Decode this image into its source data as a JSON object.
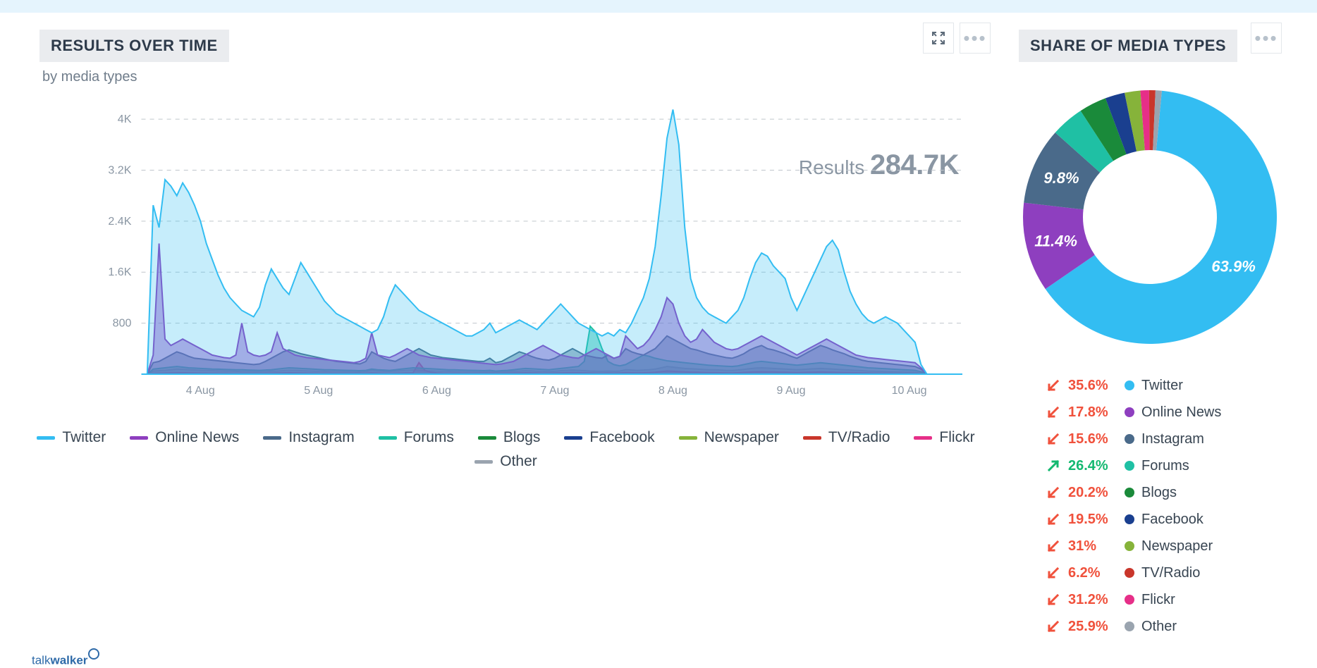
{
  "left": {
    "title": "RESULTS OVER TIME",
    "subtitle": "by media types",
    "results_label": "Results",
    "results_total": "284.7K"
  },
  "right": {
    "title": "SHARE OF MEDIA TYPES"
  },
  "colors": {
    "twitter": "#33bdf2",
    "onlinenews": "#8e3fbf",
    "instagram": "#4a6a8a",
    "forums": "#1fc0a4",
    "blogs": "#1a8a3a",
    "facebook": "#1a3f8f",
    "newspaper": "#86b33a",
    "tvradio": "#c9362b",
    "flickr": "#e62f88",
    "other": "#9aa4af"
  },
  "legend": [
    {
      "key": "twitter",
      "label": "Twitter"
    },
    {
      "key": "onlinenews",
      "label": "Online News"
    },
    {
      "key": "instagram",
      "label": "Instagram"
    },
    {
      "key": "forums",
      "label": "Forums"
    },
    {
      "key": "blogs",
      "label": "Blogs"
    },
    {
      "key": "facebook",
      "label": "Facebook"
    },
    {
      "key": "newspaper",
      "label": "Newspaper"
    },
    {
      "key": "tvradio",
      "label": "TV/Radio"
    },
    {
      "key": "flickr",
      "label": "Flickr"
    },
    {
      "key": "other",
      "label": "Other"
    }
  ],
  "trends": [
    {
      "key": "twitter",
      "label": "Twitter",
      "pct": "35.6%",
      "dir": "down"
    },
    {
      "key": "onlinenews",
      "label": "Online News",
      "pct": "17.8%",
      "dir": "down"
    },
    {
      "key": "instagram",
      "label": "Instagram",
      "pct": "15.6%",
      "dir": "down"
    },
    {
      "key": "forums",
      "label": "Forums",
      "pct": "26.4%",
      "dir": "up"
    },
    {
      "key": "blogs",
      "label": "Blogs",
      "pct": "20.2%",
      "dir": "down"
    },
    {
      "key": "facebook",
      "label": "Facebook",
      "pct": "19.5%",
      "dir": "down"
    },
    {
      "key": "newspaper",
      "label": "Newspaper",
      "pct": "31%",
      "dir": "down"
    },
    {
      "key": "tvradio",
      "label": "TV/Radio",
      "pct": "6.2%",
      "dir": "down"
    },
    {
      "key": "flickr",
      "label": "Flickr",
      "pct": "31.2%",
      "dir": "down"
    },
    {
      "key": "other",
      "label": "Other",
      "pct": "25.9%",
      "dir": "down"
    }
  ],
  "footer_brand": {
    "thin": "talk",
    "bold": "walker"
  },
  "chart_data": {
    "area": {
      "type": "area",
      "title": "Results over time by media types",
      "ylabel": "Results",
      "y_ticks": [
        800,
        1600,
        2400,
        3200,
        4000
      ],
      "y_tick_labels": [
        "800",
        "1.6K",
        "2.4K",
        "3.2K",
        "4K"
      ],
      "ylim": [
        0,
        4200
      ],
      "x_categories": [
        "4 Aug",
        "5 Aug",
        "6 Aug",
        "7 Aug",
        "8 Aug",
        "9 Aug",
        "10 Aug"
      ],
      "samples_per_day": 20,
      "series": [
        {
          "name": "Twitter",
          "key": "twitter",
          "values": [
            0,
            0,
            2650,
            2300,
            3050,
            2950,
            2800,
            3000,
            2850,
            2650,
            2400,
            2050,
            1800,
            1550,
            1350,
            1200,
            1100,
            1000,
            950,
            900,
            1050,
            1400,
            1650,
            1500,
            1350,
            1250,
            1500,
            1750,
            1600,
            1450,
            1300,
            1150,
            1050,
            950,
            900,
            850,
            800,
            750,
            700,
            650,
            700,
            900,
            1200,
            1400,
            1300,
            1200,
            1100,
            1000,
            950,
            900,
            850,
            800,
            750,
            700,
            650,
            600,
            600,
            650,
            700,
            800,
            650,
            700,
            750,
            800,
            850,
            800,
            750,
            700,
            800,
            900,
            1000,
            1100,
            1000,
            900,
            800,
            750,
            700,
            650,
            600,
            650,
            600,
            700,
            650,
            800,
            1000,
            1200,
            1500,
            2000,
            2800,
            3700,
            4150,
            3600,
            2300,
            1500,
            1200,
            1050,
            950,
            900,
            850,
            800,
            900,
            1000,
            1200,
            1500,
            1750,
            1900,
            1850,
            1700,
            1600,
            1500,
            1200,
            1000,
            1200,
            1400,
            1600,
            1800,
            2000,
            2100,
            1950,
            1600,
            1300,
            1100,
            950,
            850,
            800,
            850,
            900,
            850,
            800,
            700,
            600,
            500,
            150,
            0,
            0,
            0,
            0,
            0,
            0,
            0
          ]
        },
        {
          "name": "Online News",
          "key": "onlinenews",
          "values": [
            0,
            0,
            300,
            2050,
            550,
            450,
            500,
            550,
            500,
            450,
            400,
            350,
            300,
            280,
            260,
            250,
            300,
            800,
            350,
            300,
            280,
            300,
            350,
            650,
            400,
            350,
            300,
            280,
            260,
            250,
            240,
            230,
            220,
            210,
            200,
            190,
            180,
            200,
            250,
            650,
            300,
            280,
            260,
            300,
            350,
            400,
            350,
            300,
            280,
            260,
            250,
            240,
            230,
            220,
            210,
            200,
            190,
            180,
            170,
            160,
            150,
            160,
            180,
            200,
            250,
            300,
            350,
            400,
            450,
            400,
            350,
            300,
            280,
            260,
            250,
            300,
            350,
            400,
            350,
            300,
            250,
            280,
            600,
            500,
            400,
            450,
            550,
            700,
            900,
            1200,
            1100,
            800,
            600,
            500,
            550,
            700,
            600,
            500,
            450,
            400,
            380,
            400,
            450,
            500,
            550,
            600,
            550,
            500,
            450,
            400,
            350,
            300,
            350,
            400,
            450,
            500,
            550,
            500,
            450,
            400,
            350,
            300,
            280,
            260,
            250,
            240,
            230,
            220,
            210,
            200,
            190,
            180,
            100,
            0,
            0,
            0,
            0,
            0,
            0,
            0
          ]
        },
        {
          "name": "Instagram",
          "key": "instagram",
          "values": [
            0,
            0,
            180,
            200,
            250,
            300,
            350,
            320,
            280,
            250,
            240,
            230,
            220,
            210,
            200,
            190,
            180,
            170,
            160,
            150,
            160,
            200,
            250,
            300,
            350,
            380,
            350,
            320,
            300,
            280,
            260,
            240,
            220,
            200,
            190,
            180,
            170,
            160,
            200,
            350,
            300,
            250,
            220,
            200,
            250,
            300,
            350,
            400,
            350,
            300,
            280,
            260,
            250,
            240,
            230,
            220,
            210,
            200,
            200,
            250,
            180,
            200,
            250,
            300,
            350,
            320,
            280,
            250,
            230,
            220,
            250,
            300,
            350,
            400,
            350,
            300,
            280,
            260,
            250,
            300,
            250,
            280,
            400,
            350,
            320,
            300,
            350,
            400,
            500,
            600,
            550,
            500,
            450,
            400,
            380,
            350,
            320,
            300,
            280,
            260,
            250,
            280,
            320,
            380,
            420,
            450,
            400,
            380,
            350,
            320,
            280,
            250,
            300,
            350,
            400,
            450,
            420,
            380,
            350,
            320,
            280,
            250,
            220,
            200,
            190,
            180,
            170,
            160,
            150,
            140,
            130,
            120,
            80,
            0,
            0,
            0,
            0,
            0,
            0,
            0
          ]
        },
        {
          "name": "Forums",
          "key": "forums",
          "values": [
            0,
            0,
            80,
            90,
            100,
            110,
            120,
            110,
            100,
            95,
            90,
            85,
            80,
            78,
            75,
            72,
            70,
            68,
            65,
            62,
            60,
            65,
            70,
            80,
            90,
            100,
            95,
            90,
            85,
            80,
            75,
            70,
            68,
            65,
            62,
            60,
            58,
            55,
            60,
            80,
            70,
            65,
            60,
            70,
            80,
            90,
            100,
            95,
            90,
            85,
            80,
            75,
            70,
            68,
            65,
            62,
            60,
            58,
            55,
            60,
            50,
            55,
            60,
            70,
            80,
            90,
            85,
            80,
            75,
            70,
            80,
            90,
            100,
            110,
            120,
            200,
            750,
            650,
            400,
            200,
            150,
            130,
            150,
            200,
            250,
            300,
            280,
            250,
            230,
            210,
            200,
            190,
            180,
            170,
            160,
            150,
            140,
            135,
            130,
            125,
            120,
            130,
            150,
            170,
            190,
            200,
            190,
            180,
            170,
            160,
            150,
            140,
            150,
            160,
            170,
            180,
            170,
            160,
            150,
            140,
            130,
            120,
            110,
            100,
            95,
            90,
            85,
            80,
            75,
            70,
            65,
            60,
            40,
            0,
            0,
            0,
            0,
            0,
            0,
            0
          ]
        },
        {
          "name": "Other",
          "key": "other",
          "values": [
            0,
            0,
            50,
            55,
            60,
            70,
            80,
            75,
            70,
            65,
            60,
            58,
            55,
            52,
            50,
            48,
            45,
            42,
            40,
            38,
            35,
            40,
            45,
            50,
            55,
            60,
            58,
            55,
            52,
            50,
            48,
            45,
            42,
            40,
            38,
            35,
            34,
            33,
            40,
            60,
            50,
            45,
            42,
            50,
            55,
            60,
            65,
            60,
            55,
            52,
            50,
            48,
            45,
            42,
            40,
            38,
            35,
            34,
            32,
            35,
            30,
            35,
            40,
            45,
            50,
            55,
            52,
            48,
            45,
            42,
            48,
            55,
            60,
            65,
            60,
            55,
            50,
            48,
            45,
            50,
            45,
            50,
            70,
            65,
            60,
            65,
            70,
            80,
            100,
            120,
            110,
            100,
            90,
            85,
            80,
            75,
            70,
            68,
            65,
            60,
            58,
            65,
            75,
            85,
            95,
            100,
            95,
            90,
            85,
            80,
            75,
            70,
            75,
            80,
            85,
            90,
            85,
            80,
            75,
            70,
            65,
            60,
            55,
            50,
            48,
            45,
            42,
            40,
            38,
            35,
            33,
            30,
            20,
            0,
            0,
            0,
            0,
            0,
            0,
            0
          ]
        },
        {
          "name": "Flickr",
          "key": "flickr",
          "values": [
            0,
            0,
            10,
            12,
            15,
            18,
            20,
            22,
            20,
            18,
            16,
            15,
            14,
            13,
            12,
            11,
            10,
            10,
            10,
            10,
            10,
            12,
            15,
            18,
            20,
            22,
            20,
            18,
            16,
            15,
            14,
            13,
            12,
            11,
            10,
            10,
            10,
            10,
            12,
            20,
            15,
            12,
            10,
            12,
            15,
            18,
            20,
            180,
            60,
            30,
            20,
            15,
            14,
            13,
            12,
            11,
            10,
            10,
            10,
            12,
            10,
            12,
            15,
            18,
            20,
            22,
            20,
            18,
            16,
            15,
            18,
            20,
            22,
            25,
            22,
            20,
            18,
            16,
            15,
            18,
            15,
            18,
            25,
            22,
            20,
            22,
            25,
            30,
            40,
            50,
            45,
            40,
            35,
            32,
            30,
            28,
            25,
            24,
            22,
            20,
            18,
            22,
            28,
            32,
            36,
            38,
            36,
            34,
            32,
            30,
            28,
            26,
            28,
            30,
            32,
            34,
            32,
            30,
            28,
            26,
            24,
            22,
            20,
            18,
            16,
            15,
            14,
            13,
            12,
            11,
            10,
            10,
            5,
            0,
            0,
            0,
            0,
            0,
            0,
            0
          ]
        }
      ]
    },
    "donut": {
      "type": "pie",
      "title": "Share of media types",
      "slices": [
        {
          "name": "Twitter",
          "key": "twitter",
          "value": 63.9,
          "label": "63.9%",
          "show_label": true
        },
        {
          "name": "Online News",
          "key": "onlinenews",
          "value": 11.4,
          "label": "11.4%",
          "show_label": true
        },
        {
          "name": "Instagram",
          "key": "instagram",
          "value": 9.8,
          "label": "9.8%",
          "show_label": true
        },
        {
          "name": "Forums",
          "key": "forums",
          "value": 4.2,
          "show_label": false
        },
        {
          "name": "Blogs",
          "key": "blogs",
          "value": 3.5,
          "show_label": false
        },
        {
          "name": "Facebook",
          "key": "facebook",
          "value": 2.5,
          "show_label": false
        },
        {
          "name": "Newspaper",
          "key": "newspaper",
          "value": 2.0,
          "show_label": false
        },
        {
          "name": "Flickr",
          "key": "flickr",
          "value": 1.1,
          "show_label": false
        },
        {
          "name": "TV/Radio",
          "key": "tvradio",
          "value": 0.8,
          "show_label": false
        },
        {
          "name": "Other",
          "key": "other",
          "value": 0.8,
          "show_label": false
        }
      ]
    }
  }
}
